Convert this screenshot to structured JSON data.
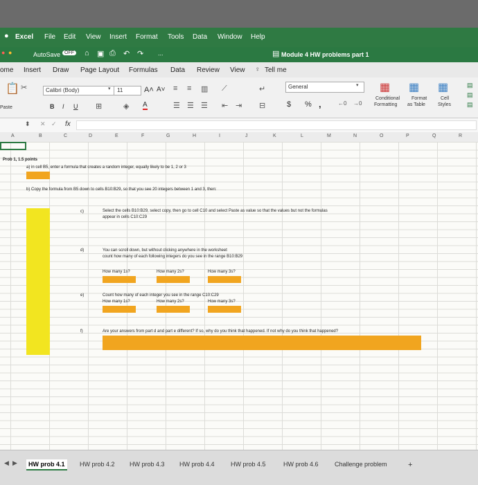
{
  "menu": {
    "app": "Excel",
    "items": [
      "File",
      "Edit",
      "View",
      "Insert",
      "Format",
      "Tools",
      "Data",
      "Window",
      "Help"
    ]
  },
  "titlebar": {
    "autosave": "AutoSave",
    "toggle": "OFF",
    "more": "...",
    "doc_title": "Module 4 HW problems part 1"
  },
  "ribbon_tabs": [
    "ome",
    "Insert",
    "Draw",
    "Page Layout",
    "Formulas",
    "Data",
    "Review",
    "View"
  ],
  "tell_me": "Tell me",
  "ribbon": {
    "font_name": "Calibri (Body)",
    "font_size": "11",
    "bold": "B",
    "italic": "I",
    "underline": "U",
    "paste": "Paste",
    "number_format": "General",
    "currency": "$",
    "percent": "%",
    "comma": ",",
    "conditional": "Conditional",
    "formatting": "Formatting",
    "format_as": "Format",
    "as_table": "as Table",
    "cell": "Cell",
    "styles": "Styles"
  },
  "formula_bar": {
    "fx": "fx"
  },
  "columns": [
    "A",
    "B",
    "C",
    "D",
    "E",
    "F",
    "G",
    "H",
    "I",
    "J",
    "K",
    "L",
    "M",
    "N",
    "O",
    "P",
    "Q",
    "R"
  ],
  "sheet": {
    "prob_title": "Prob 1, 1.5 points",
    "a_text": "a) in cell B5, enter a formula that creates a random integer, equally likely to be 1, 2 or 3",
    "b_text": "b) Copy the formula from B5 down to cells B10:B29, so that you see 20 integers between 1 and 3, then:",
    "c_label": "c)",
    "c_text1": "Select the cells B10:B29, select copy, then go to cell C10 and select Paste as value so that the values but not the formulas",
    "c_text2": "appear in cells C10:C29",
    "d_label": "d)",
    "d_text1": "You can scroll down, but without clicking anywhere in the worksheet",
    "d_text2": "count how many of each following integers do you see in the range B10:B29",
    "how1": "How many 1s?",
    "how2": "How many 2s?",
    "how3": "How many 3s?",
    "e_label": "e)",
    "e_text": "Count how many of each integer you see in the range C10:C29",
    "f_label": "f)",
    "f_text": "Are your answers from part d and part e different? If so, why do you think that happened. If not why do you think that happened?"
  },
  "sheet_tabs": [
    "HW prob 4.1",
    "HW prob 4.2",
    "HW prob 4.3",
    "HW prob 4.4",
    "HW prob 4.5",
    "HW prob 4.6",
    "Challenge problem"
  ],
  "add_sheet": "+",
  "colors": {
    "excel_green": "#2b7942",
    "orange": "#f1a51f",
    "yellow": "#f2e520"
  }
}
